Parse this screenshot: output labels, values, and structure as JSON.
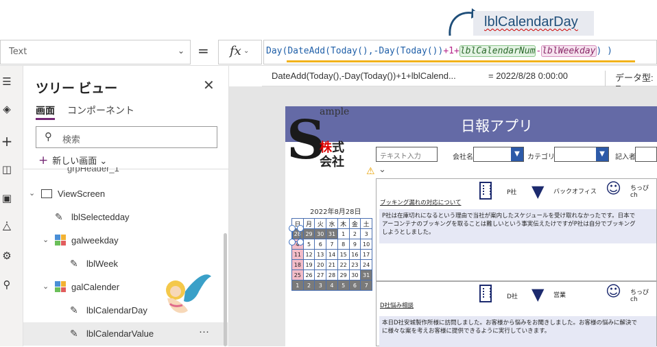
{
  "annotation": {
    "label": "lblCalendarDay"
  },
  "formula_bar": {
    "property": "Text",
    "equals": "=",
    "fx": "fx",
    "formula_parts": {
      "p1": "Day(",
      "p2": "DateAdd(",
      "p3": "Today(),-",
      "p4": "Day(",
      "p5": "Today())",
      "p6": "+1+",
      "p7": "lblCalendarNum",
      "p8": "-",
      "p9": "lblWeekday",
      "p10": ") )"
    },
    "eval_expression": "DateAdd(Today(),-Day(Today())+1+lblCalend...",
    "eval_result": "=  2022/8/28 0:00:00",
    "data_type": "データ型: E"
  },
  "tree_view": {
    "title": "ツリー ビュー",
    "tab_screens": "画面",
    "tab_components": "コンポーネント",
    "search_placeholder": "検索",
    "new_screen": "新しい画面",
    "cut_item": "grpHeader_1",
    "items": [
      "ViewScreen",
      "lblSelectedday",
      "galweekday",
      "lblWeek",
      "galCalender",
      "lblCalendarDay",
      "lblCalendarValue"
    ],
    "more": "···"
  },
  "app": {
    "header": "日報アプリ",
    "logo_sample": "ample",
    "logo_kabu": "株",
    "logo_shiki": "式",
    "logo_kaisha": "会社",
    "text_input_placeholder": "テキスト入力",
    "company_label": "会社名",
    "category_label": "カテゴリ",
    "recorder_label": "記入者",
    "calendar_title": "2022年8月28日",
    "weekdays": [
      "日",
      "月",
      "火",
      "水",
      "木",
      "金",
      "土"
    ],
    "calendar_rows": [
      [
        "28",
        "29",
        "30",
        "31",
        "1",
        "2",
        "3"
      ],
      [
        "4",
        "5",
        "6",
        "7",
        "8",
        "9",
        "10"
      ],
      [
        "11",
        "12",
        "13",
        "14",
        "15",
        "16",
        "17"
      ],
      [
        "18",
        "19",
        "20",
        "21",
        "22",
        "23",
        "24"
      ],
      [
        "25",
        "26",
        "27",
        "28",
        "29",
        "30",
        "31"
      ],
      [
        "1",
        "2",
        "3",
        "4",
        "5",
        "6",
        "7"
      ]
    ],
    "cards": [
      {
        "title": "ブッキング漏れの対応について",
        "company": "P社",
        "category": "バックオフィス",
        "person": "ちっぴ ch",
        "body": "P社は在庫切れになるという理由で当社が案内したスケジュールを受け取れなかったです。日本で\nアーコンテナのブッキングを取ることは難しいという事実伝えたけですがP社は自分でブッキング\nしようとしました。"
      },
      {
        "title": "D社悩み相談",
        "company": "D社",
        "category": "営業",
        "person": "ちっぴ ch",
        "body": "本日D社安城製作所様に訪問しました。お客様から悩みをお聞きしました。お客様の悩みに解決で\nに様々な案を考えお客様に提供できるように実行していきます。"
      }
    ]
  },
  "colors": {
    "header": "#646aa6",
    "accent_blue": "#2d5aa8",
    "formula_yellow": "#f1b21a",
    "cal_gray": "#7a7a7a",
    "cal_pink": "#f3bcc8"
  }
}
